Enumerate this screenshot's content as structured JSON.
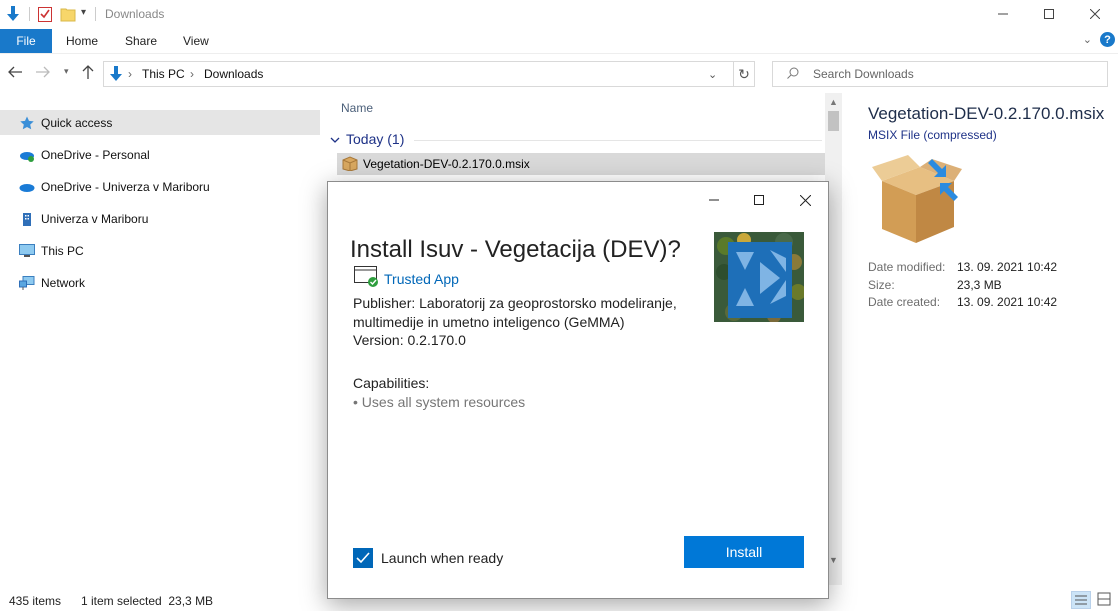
{
  "window": {
    "title": "Downloads"
  },
  "ribbon": {
    "file": "File",
    "home": "Home",
    "share": "Share",
    "view": "View",
    "help": "?"
  },
  "address": {
    "crumbs": [
      "This PC",
      "Downloads"
    ],
    "search_placeholder": "Search Downloads"
  },
  "nav": {
    "items": [
      {
        "label": "Quick access",
        "icon": "star-icon"
      },
      {
        "label": "OneDrive - Personal",
        "icon": "onedrive-icon"
      },
      {
        "label": "OneDrive - Univerza v Mariboru",
        "icon": "onedrive-icon"
      },
      {
        "label": "Univerza v Mariboru",
        "icon": "building-icon"
      },
      {
        "label": "This PC",
        "icon": "computer-icon"
      },
      {
        "label": "Network",
        "icon": "network-icon"
      }
    ]
  },
  "filelist": {
    "column_name": "Name",
    "group": "Today (1)",
    "file": "Vegetation-DEV-0.2.170.0.msix"
  },
  "details": {
    "title": "Vegetation-DEV-0.2.170.0.msix",
    "type": "MSIX File (compressed)",
    "modified_label": "Date modified:",
    "modified_value": "13. 09. 2021 10:42",
    "size_label": "Size:",
    "size_value": "23,3 MB",
    "created_label": "Date created:",
    "created_value": "13. 09. 2021 10:42"
  },
  "status": {
    "items": "435 items",
    "selected": "1 item selected  23,3 MB"
  },
  "dialog": {
    "title": "Install Isuv - Vegetacija (DEV)?",
    "trusted": "Trusted App",
    "publisher": "Publisher: Laboratorij za geoprostorsko modeliranje, multimedije in umetno inteligenco (GeMMA)",
    "version": "Version: 0.2.170.0",
    "capabilities_label": "Capabilities:",
    "capability": "• Uses all system resources",
    "launch_label": "Launch when ready",
    "launch_checked": true,
    "install_label": "Install"
  },
  "colors": {
    "accent": "#0078d7",
    "file_tab": "#1979ca",
    "link": "#0067b8"
  }
}
